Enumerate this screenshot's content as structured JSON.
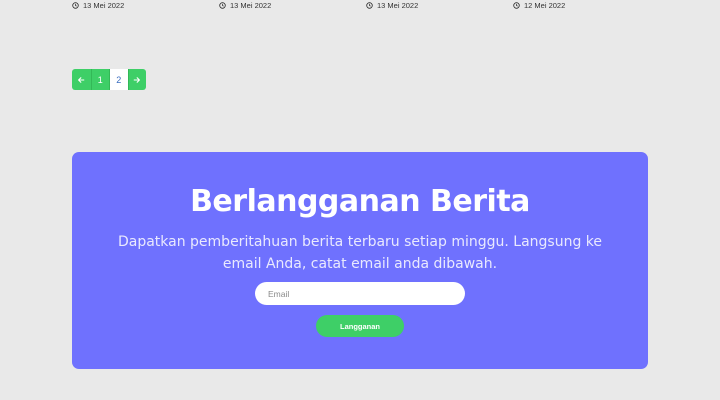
{
  "news_dates": [
    {
      "date": "13 Mei 2022",
      "icon": "clock-icon"
    },
    {
      "date": "13 Mei 2022",
      "icon": "clock-icon"
    },
    {
      "date": "13 Mei 2022",
      "icon": "clock-icon"
    },
    {
      "date": "12 Mei 2022",
      "icon": "clock-icon"
    }
  ],
  "pagination": {
    "prev_icon": "arrow-left-icon",
    "pages": [
      "1",
      "2"
    ],
    "current_page": "2",
    "next_icon": "arrow-right-icon"
  },
  "newsletter": {
    "title": "Berlangganan Berita",
    "description": "Dapatkan pemberitahuan berita terbaru setiap minggu. Langsung ke email Anda, catat email anda dibawah.",
    "email_placeholder": "Email",
    "email_value": "",
    "subscribe_label": "Langganan"
  },
  "colors": {
    "background": "#e9e9e9",
    "newsletter_bg": "#6f71fe",
    "accent_green": "#3ecf67",
    "current_page_text": "#3a6dbf"
  }
}
